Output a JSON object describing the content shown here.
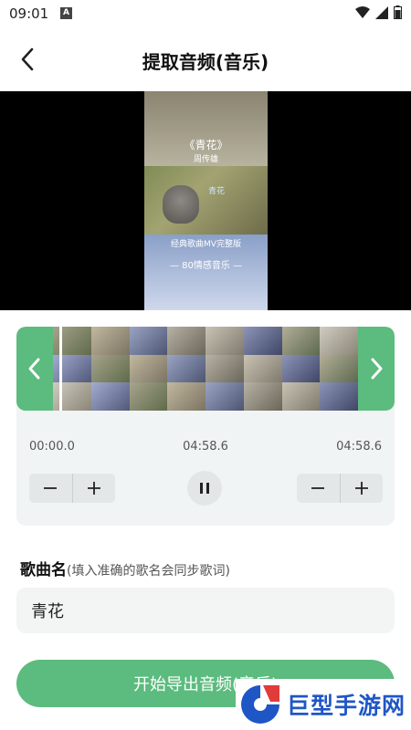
{
  "status": {
    "time": "09:01",
    "notify_icon": "A"
  },
  "header": {
    "title": "提取音频(音乐)"
  },
  "video": {
    "title": "《青花》",
    "artist": "周传雄",
    "center_text": "青花",
    "caption1": "经典歌曲MV完整版",
    "caption2": "— 80情感音乐 —"
  },
  "trim": {
    "start_time": "00:00.0",
    "mid_time": "04:58.6",
    "end_time": "04:58.6"
  },
  "song": {
    "label": "歌曲名",
    "hint": "(填入准确的歌名会同步歌词)",
    "value": "青花"
  },
  "export": {
    "label": "开始导出音频(音乐)"
  },
  "watermark": {
    "text": "巨型手游网"
  },
  "colors": {
    "accent": "#5cbb7e",
    "panel": "#f1f4f4"
  }
}
